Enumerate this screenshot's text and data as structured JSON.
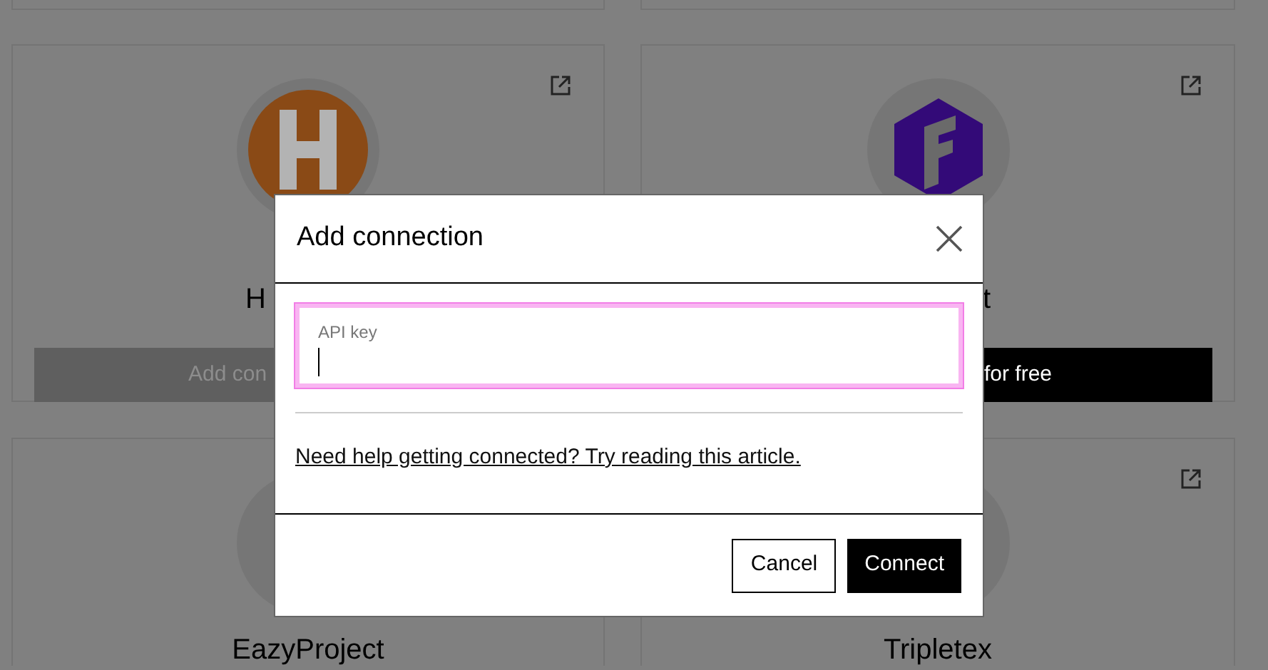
{
  "cards": [
    {
      "title": "H",
      "kind": "h",
      "button": {
        "label": "Add con",
        "disabled": true
      }
    },
    {
      "title": "t",
      "kind": "f",
      "button": {
        "label": "for free",
        "disabled": false
      }
    },
    {
      "title": "EazyProject",
      "kind": "blank"
    },
    {
      "title": "Tripletex",
      "kind": "blank"
    }
  ],
  "dialog": {
    "title": "Add connection",
    "field": {
      "label": "API key",
      "focused": true
    },
    "help_link": "Need help getting connected? Try reading this article.",
    "buttons": [
      {
        "label": "Cancel",
        "kind": "secondary"
      },
      {
        "label": "Connect",
        "kind": "primary"
      }
    ]
  }
}
